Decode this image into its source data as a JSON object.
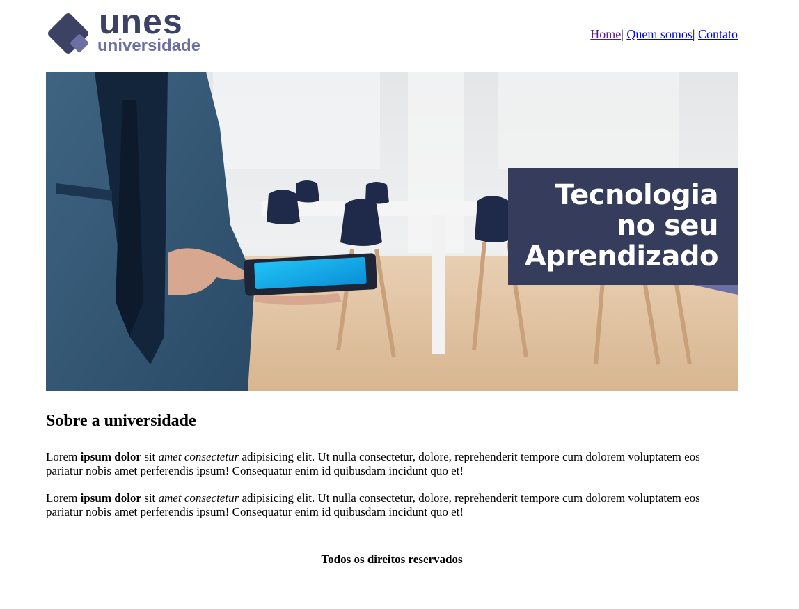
{
  "header": {
    "logo": {
      "word": "unes",
      "subword": "universidade",
      "icon": "diamond-logo-icon"
    },
    "nav": [
      {
        "label": "Home",
        "visited": true
      },
      {
        "label": "Quem somos",
        "visited": false
      },
      {
        "label": "Contato",
        "visited": false
      }
    ],
    "nav_separator": "|"
  },
  "banner": {
    "line1": "Tecnologia",
    "line2": "no seu",
    "line3": "Aprendizado"
  },
  "about": {
    "title": "Sobre a universidade",
    "paragraphs": [
      {
        "t1": "Lorem ",
        "b": "ipsum dolor",
        "t2": " sit ",
        "i": "amet consectetur",
        "t3": " adipisicing elit. Ut nulla consectetur, dolore, reprehenderit tempore cum dolorem voluptatem eos pariatur nobis amet perferendis ipsum! Consequatur enim id quibusdam incidunt quo et!"
      },
      {
        "t1": "Lorem ",
        "b": "ipsum dolor",
        "t2": " sit ",
        "i": "amet consectetur",
        "t3": " adipisicing elit. Ut nulla consectetur, dolore, reprehenderit tempore cum dolorem voluptatem eos pariatur nobis amet perferendis ipsum! Consequatur enim id quibusdam incidunt quo et!"
      }
    ]
  },
  "footer": {
    "text": "Todos os direitos reservados"
  },
  "colors": {
    "brand_dark": "#3b4263",
    "brand_light": "#6b6fa3",
    "banner_box": "#363c5c"
  }
}
